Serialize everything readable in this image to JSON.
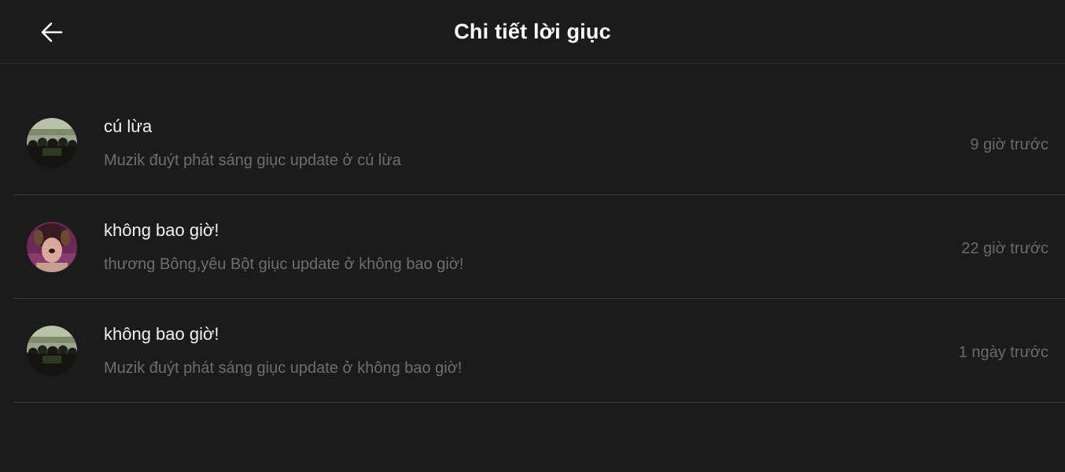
{
  "header": {
    "title": "Chi tiết lời giục",
    "back_icon": "arrow-left-icon"
  },
  "colors": {
    "background": "#1b1b1b",
    "title_text": "#ffffff",
    "primary_text": "#f2f2f2",
    "secondary_text": "#6e6e6e",
    "divider": "#3a3a3a"
  },
  "notifications": [
    {
      "title": "cú lừa",
      "subtitle": "Muzik đuýt phát sáng giục update ở cú lừa",
      "time": "9 giờ trước",
      "avatar": "crowd-photo-avatar"
    },
    {
      "title": "không bao giờ!",
      "subtitle": "thương Bông,yêu Bột giục update ở không bao giờ!",
      "time": "22 giờ trước",
      "avatar": "girl-dog-filter-avatar"
    },
    {
      "title": "không bao giờ!",
      "subtitle": "Muzik đuýt phát sáng giục update ở không bao giờ!",
      "time": "1 ngày trước",
      "avatar": "crowd-photo-avatar"
    }
  ]
}
